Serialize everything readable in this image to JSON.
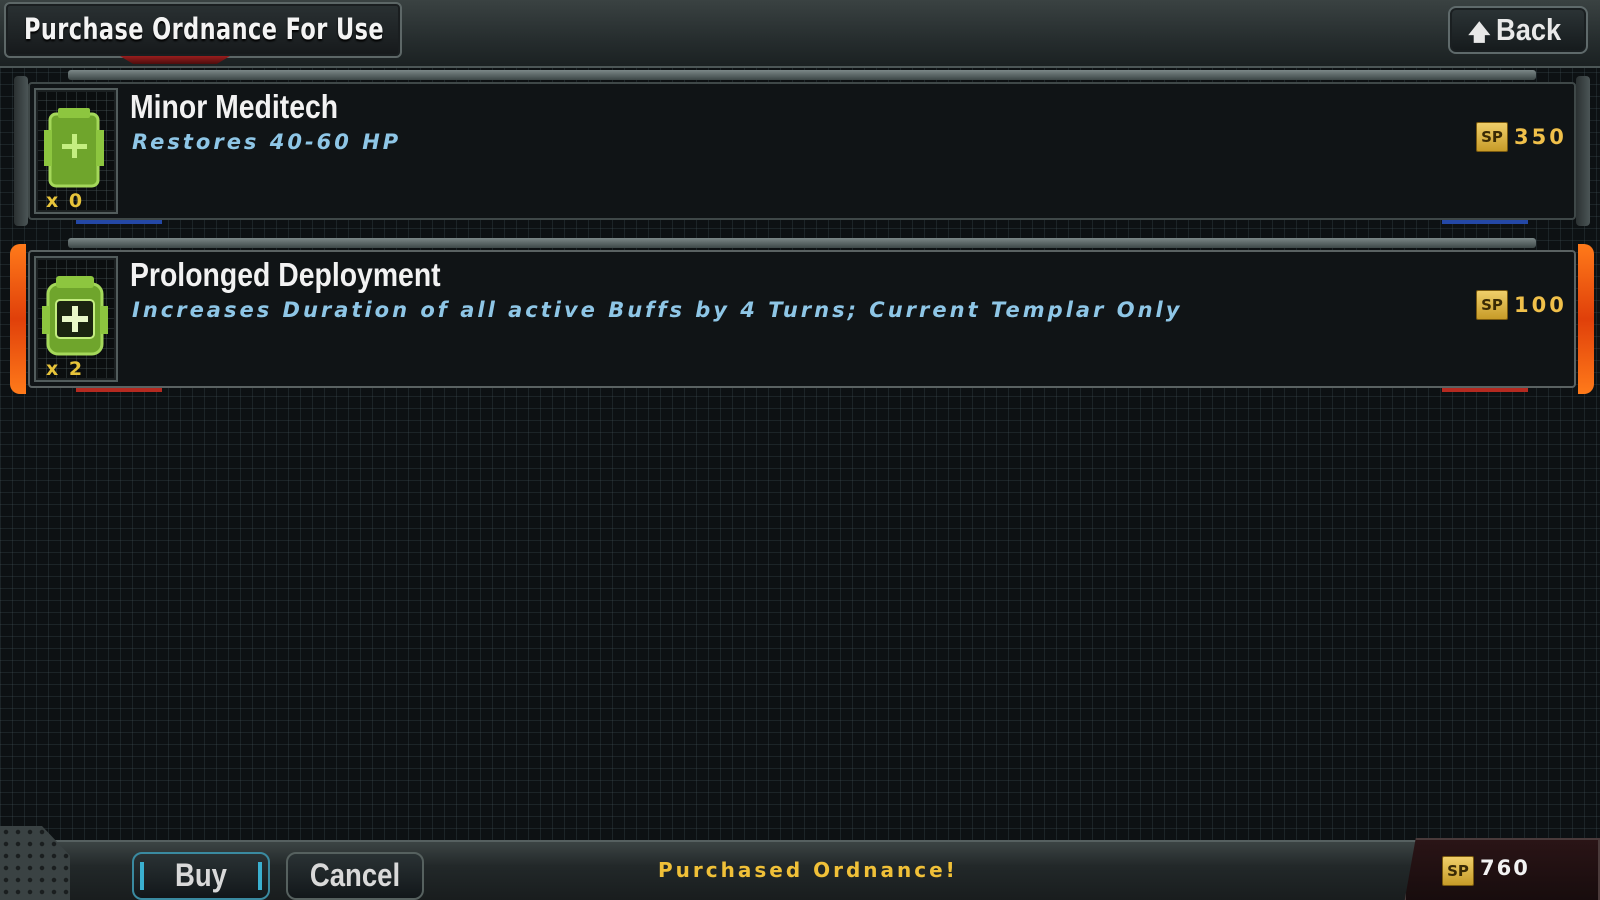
{
  "header": {
    "title": "Purchase Ordnance For Use",
    "back_label": "Back"
  },
  "items": [
    {
      "name": "Minor Meditech",
      "description": "Restores 40-60 HP",
      "quantity": "x 0",
      "currency": "SP",
      "price": "350",
      "icon": "medkit-icon"
    },
    {
      "name": "Prolonged Deployment",
      "description": "Increases Duration of all active Buffs by 4 Turns; Current Templar Only",
      "quantity": "x 2",
      "currency": "SP",
      "price": "100",
      "icon": "buff-pack-icon",
      "selected": true
    }
  ],
  "footer": {
    "buy_label": "Buy",
    "cancel_label": "Cancel",
    "status": "Purchased Ordnance!",
    "currency": "SP",
    "balance": "760"
  },
  "colors": {
    "accent_selected": "#f06018",
    "price": "#f0c04a",
    "description": "#8ec6e6",
    "status": "#f0c038",
    "icon_green": "#8dc63f"
  }
}
